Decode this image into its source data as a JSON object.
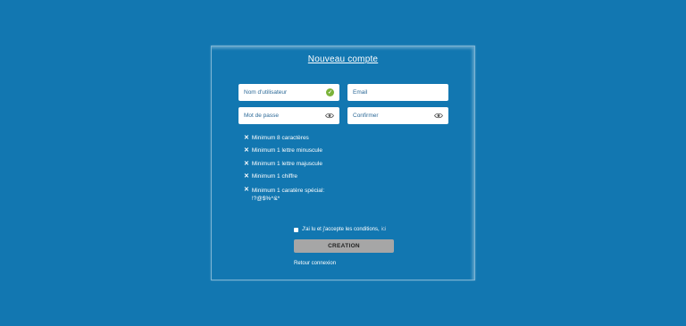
{
  "form": {
    "title": "Nouveau compte",
    "username_placeholder": "Nom d'utilisateur",
    "email_placeholder": "Email",
    "password_placeholder": "Mot de passe",
    "confirm_placeholder": "Confirmer",
    "user_badge_icon": "user-check-icon",
    "eye_icon": "eye-icon"
  },
  "rules": {
    "mark": "✕",
    "items": [
      "Minimum 8 caractères",
      "Minimum 1 lettre minuscule",
      "Minimum 1 lettre majuscule",
      "Minimum 1 chiffre",
      "Minimum 1 caratère spécial:",
      "!?@$%^&*"
    ]
  },
  "terms": {
    "label": "J'ai lu et j'accepte les conditions,",
    "link": "ici"
  },
  "actions": {
    "create_label": "CREATION",
    "back_label": "Retour connexion"
  },
  "colors": {
    "background": "#1277b1",
    "button": "#a6a6a6",
    "badge": "#7bb33a"
  }
}
